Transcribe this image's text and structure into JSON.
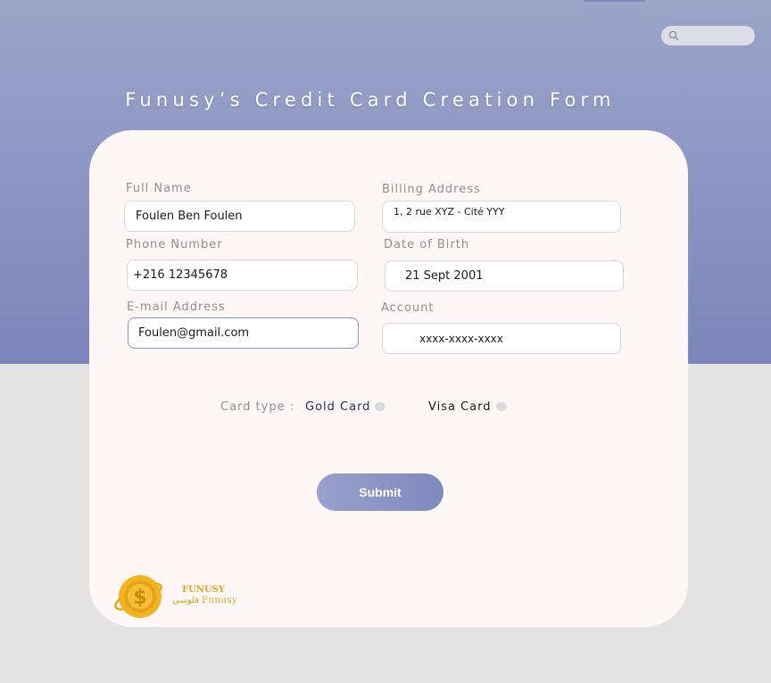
{
  "header": {
    "title": "Funusy’s Credit Card Creation Form",
    "search": {
      "placeholder": "",
      "icon": "search-icon"
    }
  },
  "form": {
    "full_name": {
      "label": "Full Name",
      "value": "Foulen Ben Foulen"
    },
    "billing_address": {
      "label": "Billing Address",
      "value": "1, 2 rue XYZ - Cité YYY"
    },
    "phone": {
      "label": "Phone Number",
      "value": "+216 12345678"
    },
    "dob": {
      "label": "Date of Birth",
      "value": "21 Sept 2001"
    },
    "email": {
      "label": "E-mail Address",
      "value": "Foulen@gmail.com"
    },
    "account": {
      "label": "Account",
      "value": "xxxx-xxxx-xxxx"
    },
    "card_type": {
      "label": "Card type :",
      "options": [
        "Gold Card",
        "Visa Card"
      ]
    },
    "submit_label": "Submit"
  },
  "brand": {
    "name": "FUNUSY",
    "tagline": "فلوسي Funusy",
    "coin_color": "#f2b320"
  },
  "colors": {
    "accent": "#8a93c7",
    "background": "#e3e3e3",
    "card": "#fdf8f7"
  }
}
